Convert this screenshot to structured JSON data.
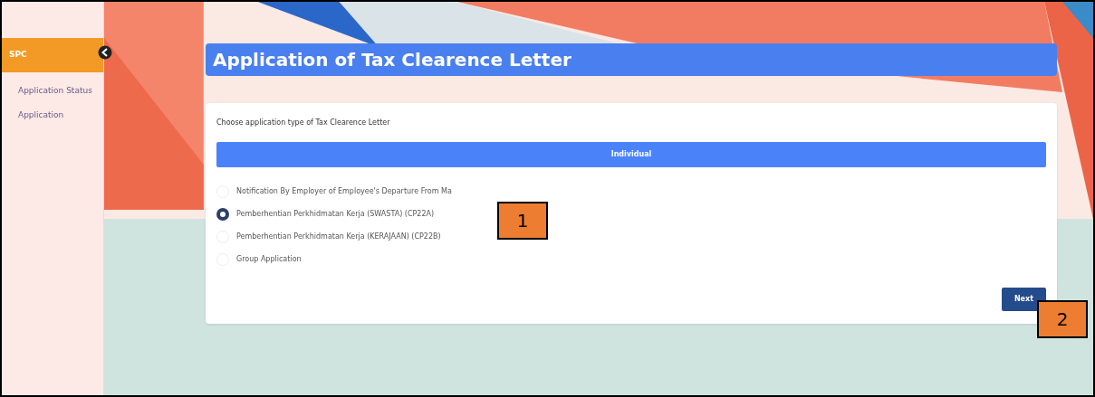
{
  "sidebar": {
    "items": [
      {
        "label": "SPC",
        "selected": true
      },
      {
        "label": "Application Status",
        "selected": false
      },
      {
        "label": "Application",
        "selected": false
      }
    ]
  },
  "page_title": "Application of Tax Clearence Letter",
  "form": {
    "heading": "Choose application type of Tax Clearence Letter",
    "tabs": [
      {
        "label": "Individual",
        "selected": true
      }
    ],
    "options": [
      {
        "label": "Notification By Employer of Employee's Departure From Ma",
        "selected": false
      },
      {
        "label": "Pemberhentian Perkhidmatan Kerja (SWASTA) (CP22A)",
        "selected": true
      },
      {
        "label": "Pemberhentian Perkhidmatan Kerja (KERAJAAN) (CP22B)",
        "selected": false
      },
      {
        "label": "Group Application",
        "selected": false
      }
    ],
    "next_button": "Next"
  },
  "callouts": [
    "1",
    "2"
  ]
}
